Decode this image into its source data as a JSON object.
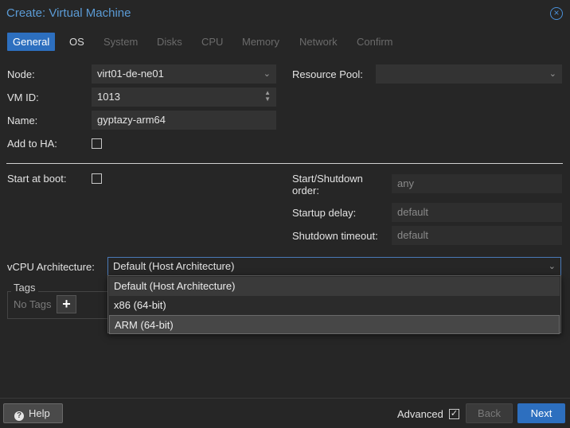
{
  "window": {
    "title": "Create: Virtual Machine",
    "close_icon": "close-icon"
  },
  "tabs": [
    {
      "label": "General",
      "state": "active"
    },
    {
      "label": "OS",
      "state": "enabled"
    },
    {
      "label": "System",
      "state": "disabled"
    },
    {
      "label": "Disks",
      "state": "disabled"
    },
    {
      "label": "CPU",
      "state": "disabled"
    },
    {
      "label": "Memory",
      "state": "disabled"
    },
    {
      "label": "Network",
      "state": "disabled"
    },
    {
      "label": "Confirm",
      "state": "disabled"
    }
  ],
  "general": {
    "node_label": "Node:",
    "node_value": "virt01-de-ne01",
    "vmid_label": "VM ID:",
    "vmid_value": "1013",
    "name_label": "Name:",
    "name_value": "gyptazy-arm64",
    "ha_label": "Add to HA:",
    "ha_checked": false,
    "pool_label": "Resource Pool:",
    "pool_value": "",
    "boot_label": "Start at boot:",
    "boot_checked": false,
    "order_label_1": "Start/Shutdown",
    "order_label_2": "order:",
    "order_value": "any",
    "startup_label": "Startup delay:",
    "startup_value": "default",
    "shutdown_label": "Shutdown timeout:",
    "shutdown_value": "default",
    "vcpu_label": "vCPU Architecture:",
    "vcpu_value": "Default (Host Architecture)",
    "vcpu_options": [
      "Default (Host Architecture)",
      "x86 (64-bit)",
      "ARM (64-bit)"
    ],
    "vcpu_highlighted": "ARM (64-bit)"
  },
  "tags": {
    "legend": "Tags",
    "empty_text": "No Tags",
    "add_symbol": "+"
  },
  "footer": {
    "help_label": "Help",
    "help_icon_glyph": "?",
    "advanced_label": "Advanced",
    "advanced_checked": true,
    "advanced_check_glyph": "✓",
    "back_label": "Back",
    "next_label": "Next"
  },
  "colors": {
    "accent": "#2d6fbf",
    "title": "#5b9bd5",
    "background": "#262626"
  }
}
